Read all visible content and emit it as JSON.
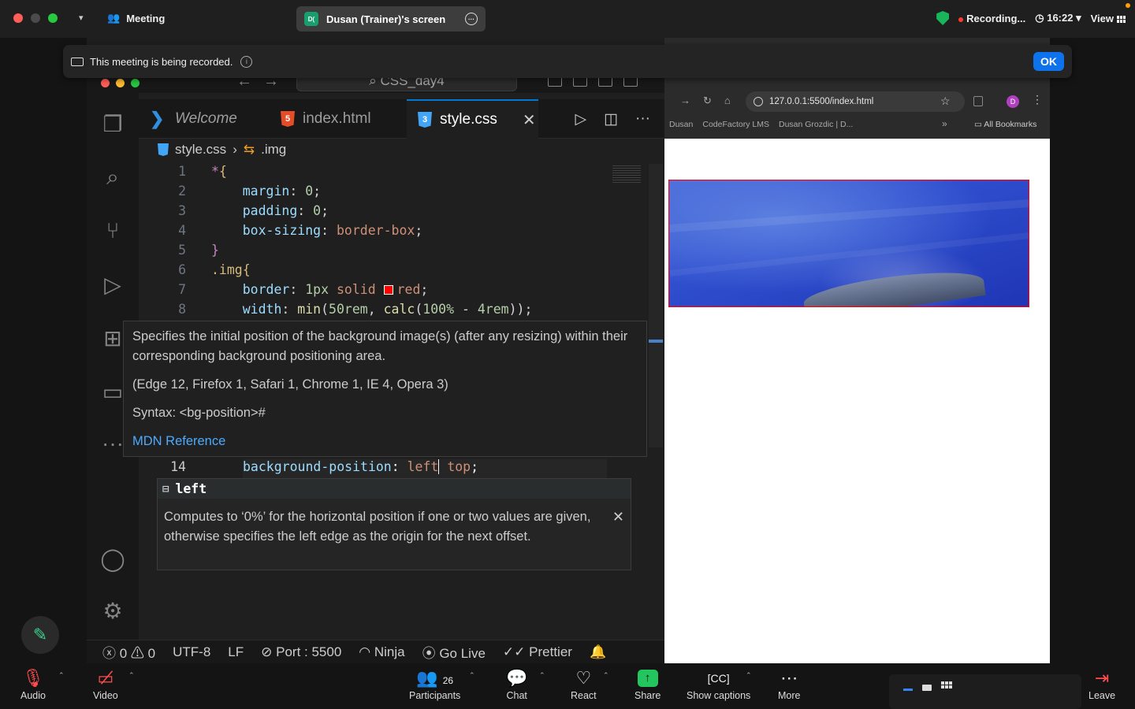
{
  "zoom_top": {
    "meeting_label": "Meeting",
    "screen_badge": "D(",
    "screen_title": "Dusan (Trainer)'s screen",
    "recording_label": "Recording...",
    "time": "16:22",
    "view_label": "View"
  },
  "banner": {
    "message": "This meeting is being recorded.",
    "ok_label": "OK"
  },
  "vscode": {
    "search_text": "CSS_day4",
    "tabs": [
      {
        "label": "Welcome"
      },
      {
        "label": "index.html"
      },
      {
        "label": "style.css"
      }
    ],
    "breadcrumb": {
      "file": "style.css",
      "symbol": ".img"
    },
    "code_lines": [
      {
        "n": "1"
      },
      {
        "n": "2"
      },
      {
        "n": "3"
      },
      {
        "n": "4"
      },
      {
        "n": "5"
      },
      {
        "n": "6"
      },
      {
        "n": "7"
      },
      {
        "n": "8"
      }
    ],
    "line14": {
      "n": "14",
      "prop": "background-position",
      "val1": "left",
      "val2": "top"
    },
    "hover_doc": {
      "description": "Specifies the initial position of the background image(s) (after any resizing) within their corresponding background positioning area.",
      "browsers": "(Edge 12, Firefox 1, Safari 1, Chrome 1, IE 4, Opera 3)",
      "syntax": "Syntax: <bg-position>#",
      "link": "MDN Reference"
    },
    "suggest": {
      "item": "left",
      "detail": "Computes to ‘0%’ for the horizontal position if one or two values are given, otherwise specifies the left edge as the origin for the next offset."
    },
    "status": {
      "errors": "0",
      "warnings": "0",
      "encoding": "UTF-8",
      "eol": "LF",
      "port": "Port : 5500",
      "ninja": "Ninja",
      "go_live": "Go Live",
      "prettier": "Prettier"
    }
  },
  "browser": {
    "url": "127.0.0.1:5500/index.html",
    "avatar": "D",
    "bookmarks": [
      "Dusan",
      "CodeFactory LMS",
      "Dusan Grozdic | D..."
    ],
    "all_bookmarks": "All Bookmarks"
  },
  "zoom_bottom": {
    "audio": "Audio",
    "video": "Video",
    "participants_count": "26",
    "participants": "Participants",
    "chat": "Chat",
    "react": "React",
    "share": "Share",
    "captions": "Show captions",
    "more": "More",
    "leave": "Leave"
  }
}
